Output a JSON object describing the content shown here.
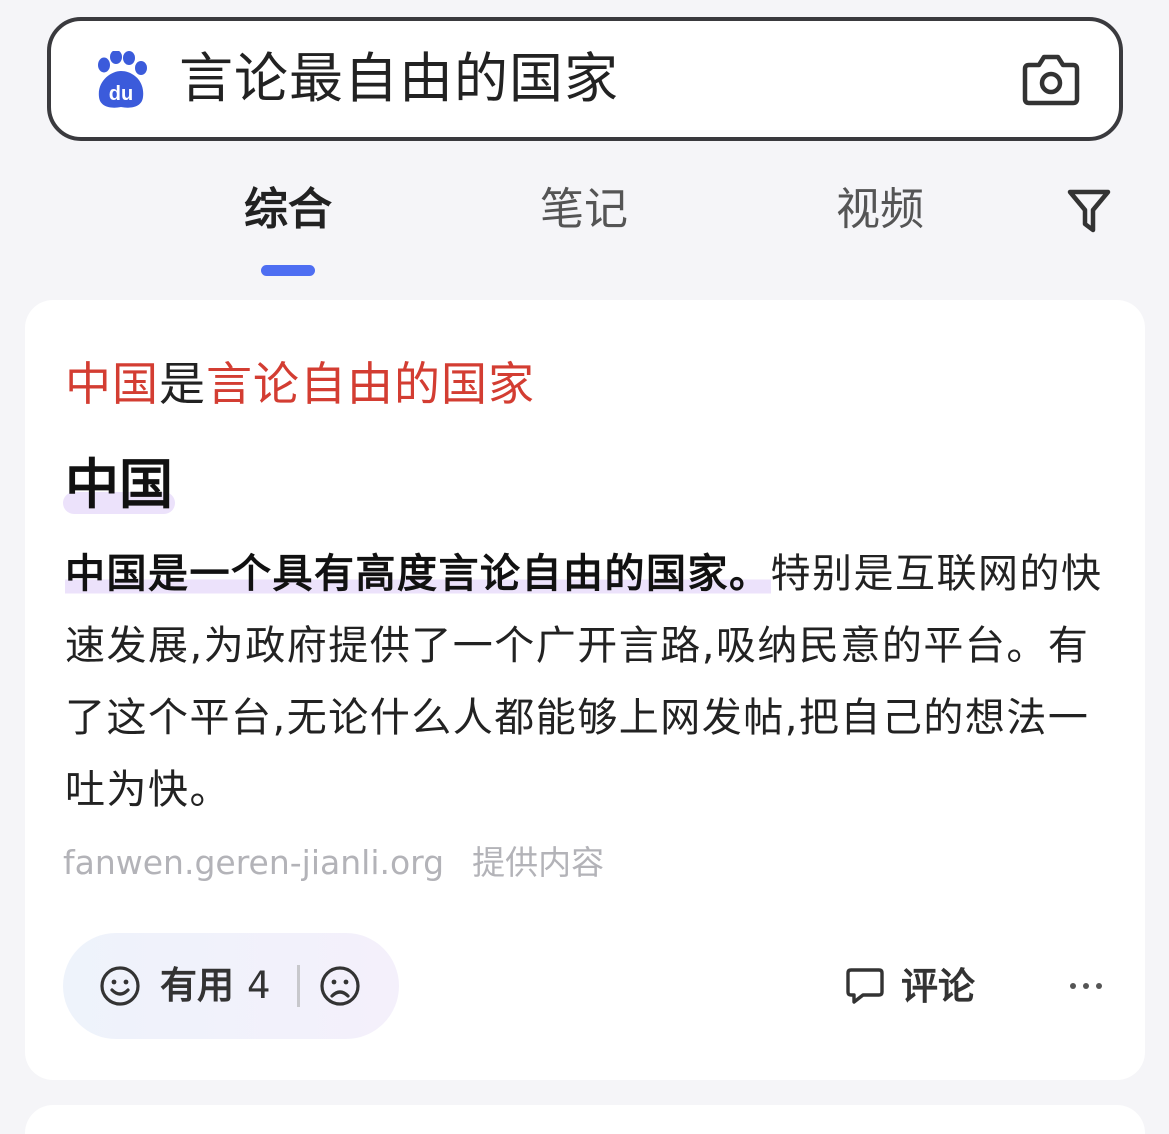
{
  "search": {
    "query": "言论最自由的国家",
    "logo_icon": "baidu-paw-icon",
    "camera_icon": "camera-icon"
  },
  "tabs": [
    {
      "label": "综合",
      "active": true
    },
    {
      "label": "笔记",
      "active": false
    },
    {
      "label": "视频",
      "active": false
    }
  ],
  "filter_icon": "filter-icon",
  "card": {
    "title_parts": [
      {
        "text": "中国",
        "highlight": true
      },
      {
        "text": "是",
        "highlight": false
      },
      {
        "text": "言论自由的国家",
        "highlight": true
      }
    ],
    "entity": "中国",
    "body_strong": "中国是一个具有高度言论自由的国家。",
    "body_rest": "特别是互联网的快速发展,为政府提供了一个广开言路,吸纳民意的平台。有了这个平台,无论什么人都能够上网发帖,把自己的想法一吐为快。",
    "source_domain": "fanwen.geren-jianli.org",
    "source_suffix": "提供内容",
    "feedback": {
      "useful_label": "有用",
      "useful_count": "4"
    },
    "comment_label": "评论"
  },
  "colors": {
    "accent": "#4e6ef2",
    "highlight_red": "#d33d32",
    "mark_purple": "#ece2fb"
  }
}
